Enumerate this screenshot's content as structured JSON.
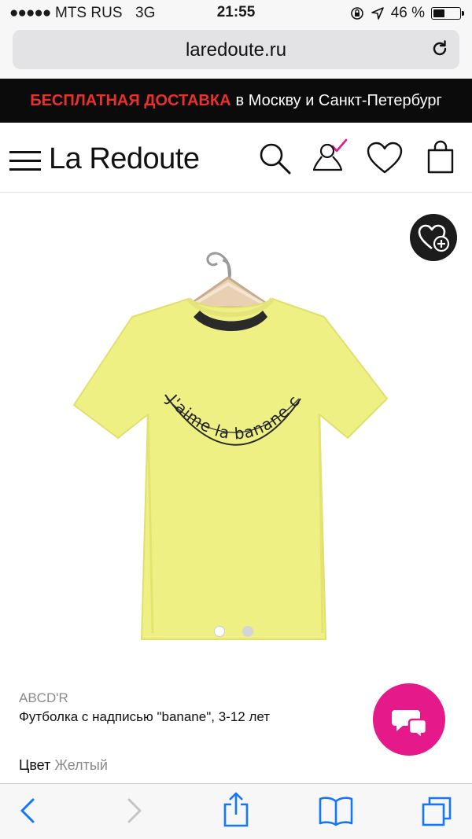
{
  "status_bar": {
    "signal": "●●●●●",
    "carrier": "MTS RUS",
    "network": "3G",
    "time": "21:55",
    "battery": "46 %",
    "battery_level": 0.46
  },
  "browser": {
    "url": "laredoute.ru"
  },
  "promo": {
    "highlight": "БЕСПЛАТНАЯ ДОСТАВКА",
    "text": "в Москву и Санкт-Петербург",
    "highlight_color": "#e8312b"
  },
  "header": {
    "logo": "La Redoute",
    "icons": [
      "menu-icon",
      "search-icon",
      "account-icon",
      "wishlist-heart-icon",
      "shopping-bag-icon"
    ]
  },
  "product": {
    "print_text": "J'aime la banane c'est super bon",
    "shirt_color": "#eef083",
    "image_count": 2,
    "active_image": 1,
    "brand": "ABCD'R",
    "name": "Футболка с надписью \"banane\", 3-12 лет",
    "color_label": "Цвет",
    "color_value": "Желтый",
    "accent_color": "#e6198a"
  },
  "toolbar": {
    "icons": [
      "back-icon",
      "forward-icon",
      "share-icon",
      "bookmarks-icon",
      "tabs-icon"
    ]
  }
}
